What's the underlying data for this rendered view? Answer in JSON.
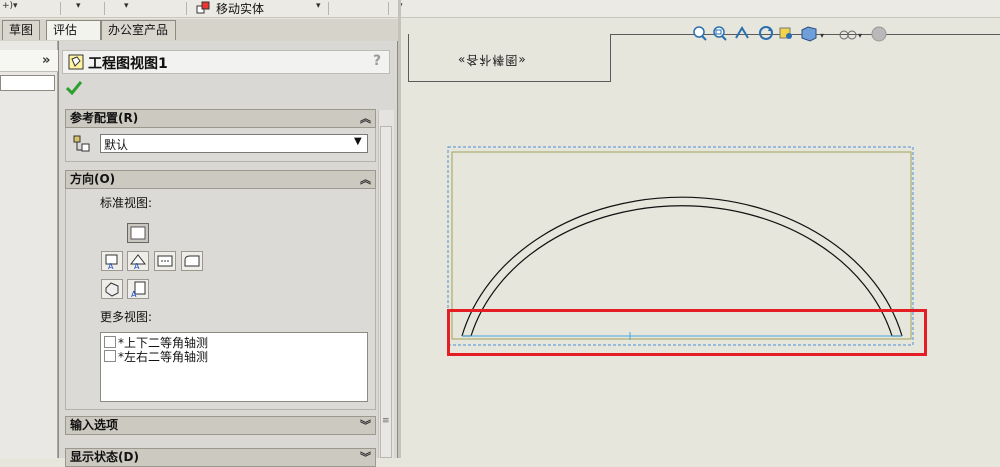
{
  "toolbar": {
    "move_solid_label": "移动实体"
  },
  "tabs": [
    "草图",
    "评估",
    "办公室产品"
  ],
  "left_panel": {
    "collapse_label": "»"
  },
  "property_manager": {
    "title": "工程图视图1",
    "help": "?",
    "sections": {
      "reference_config": {
        "label": "参考配置(R)",
        "selected": "默认"
      },
      "orientation": {
        "label": "方向(O)",
        "standard_views_label": "标准视图:",
        "more_views_label": "更多视图:",
        "more_views": [
          "*上下二等角轴测",
          "*左右二等角轴测"
        ]
      },
      "import_options": {
        "label": "输入选项"
      },
      "display_state": {
        "label": "显示状态(D)"
      }
    }
  },
  "title_block": {
    "text": "«各补棒图»"
  },
  "colors": {
    "highlight": "#e51d25",
    "dashed_border": "#4a90d9",
    "view_border": "#a3a35a"
  },
  "icons": [
    "move-solid-icon",
    "drawing-view-icon",
    "checkmark-icon",
    "configuration-icon",
    "zoom-to-fit-icon",
    "zoom-to-area-icon",
    "previous-view-icon",
    "rotate-icon",
    "pan-icon",
    "view-orientation-icon",
    "display-style-icon",
    "hide-show-icon"
  ]
}
